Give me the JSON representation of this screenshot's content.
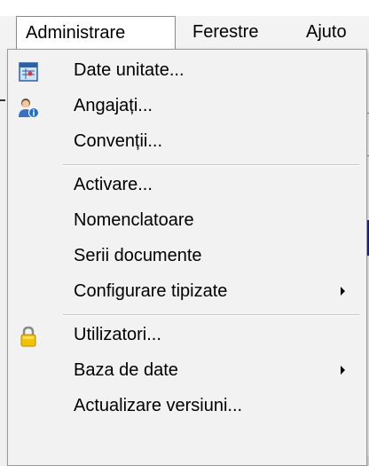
{
  "menubar": {
    "items": [
      {
        "label": "Administrare"
      },
      {
        "label": "Ferestre"
      },
      {
        "label": "Ajuto"
      }
    ]
  },
  "dropdown": {
    "groups": [
      [
        {
          "label": "Date unitate...",
          "icon": "unit-data-icon"
        },
        {
          "label": "Angajați...",
          "icon": "employees-icon"
        },
        {
          "label": "Convenții..."
        }
      ],
      [
        {
          "label": "Activare..."
        },
        {
          "label": "Nomenclatoare"
        },
        {
          "label": "Serii documente"
        },
        {
          "label": "Configurare tipizate",
          "submenu": true
        }
      ],
      [
        {
          "label": "Utilizatori...",
          "icon": "lock-icon"
        },
        {
          "label": "Baza de date",
          "submenu": true
        },
        {
          "label": "Actualizare versiuni..."
        }
      ]
    ]
  },
  "colors": {
    "menu_background": "#f2f2f2",
    "lock_icon": "#f2c200",
    "background_accent": "#1e2a78"
  }
}
